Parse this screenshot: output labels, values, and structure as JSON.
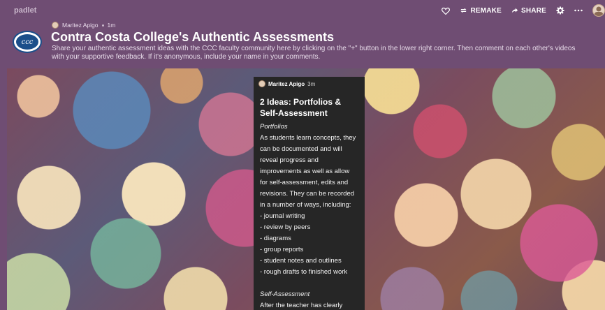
{
  "app": {
    "brand": "padlet"
  },
  "toolbar": {
    "remake_label": "REMAKE",
    "share_label": "SHARE",
    "icons": [
      "heart-icon",
      "remake-icon",
      "share-icon",
      "gear-icon",
      "more-icon",
      "avatar"
    ]
  },
  "header": {
    "author": "Maritez Apigo",
    "time": "1m",
    "title": "Contra Costa College's Authentic Assessments",
    "description": "Share your authentic assessment ideas with the CCC faculty community here by clicking on the \"+\" button in the lower right corner. Then comment on each other's videos with your supportive feedback. If it's anonymous, include your name in your comments.",
    "logo_text": "ccc"
  },
  "post": {
    "author": "Maritez Apigo",
    "time": "3m",
    "title": "2 Ideas: Portfolios & Self-Assessment",
    "lines": [
      {
        "text": "Portfolios",
        "italic": true
      },
      {
        "text": "As students learn concepts, they",
        "italic": false
      },
      {
        "text": "can be documented and will",
        "italic": false
      },
      {
        "text": "reveal progress and",
        "italic": false
      },
      {
        "text": "improvements as well as allow",
        "italic": false
      },
      {
        "text": "for self-assessment, edits and",
        "italic": false
      },
      {
        "text": "revisions. They can be recorded",
        "italic": false
      },
      {
        "text": "in a number of ways, including:",
        "italic": false
      },
      {
        "text": "- journal writing",
        "italic": false
      },
      {
        "text": "- review by peers",
        "italic": false
      },
      {
        "text": "- diagrams",
        "italic": false
      },
      {
        "text": "- group reports",
        "italic": false
      },
      {
        "text": "- student notes and outlines",
        "italic": false
      },
      {
        "text": "- rough drafts to finished work",
        "italic": false
      },
      {
        "text": "",
        "italic": false
      },
      {
        "text": "Self-Assessment",
        "italic": true
      },
      {
        "text": "After the teacher has clearly",
        "italic": false
      }
    ]
  }
}
